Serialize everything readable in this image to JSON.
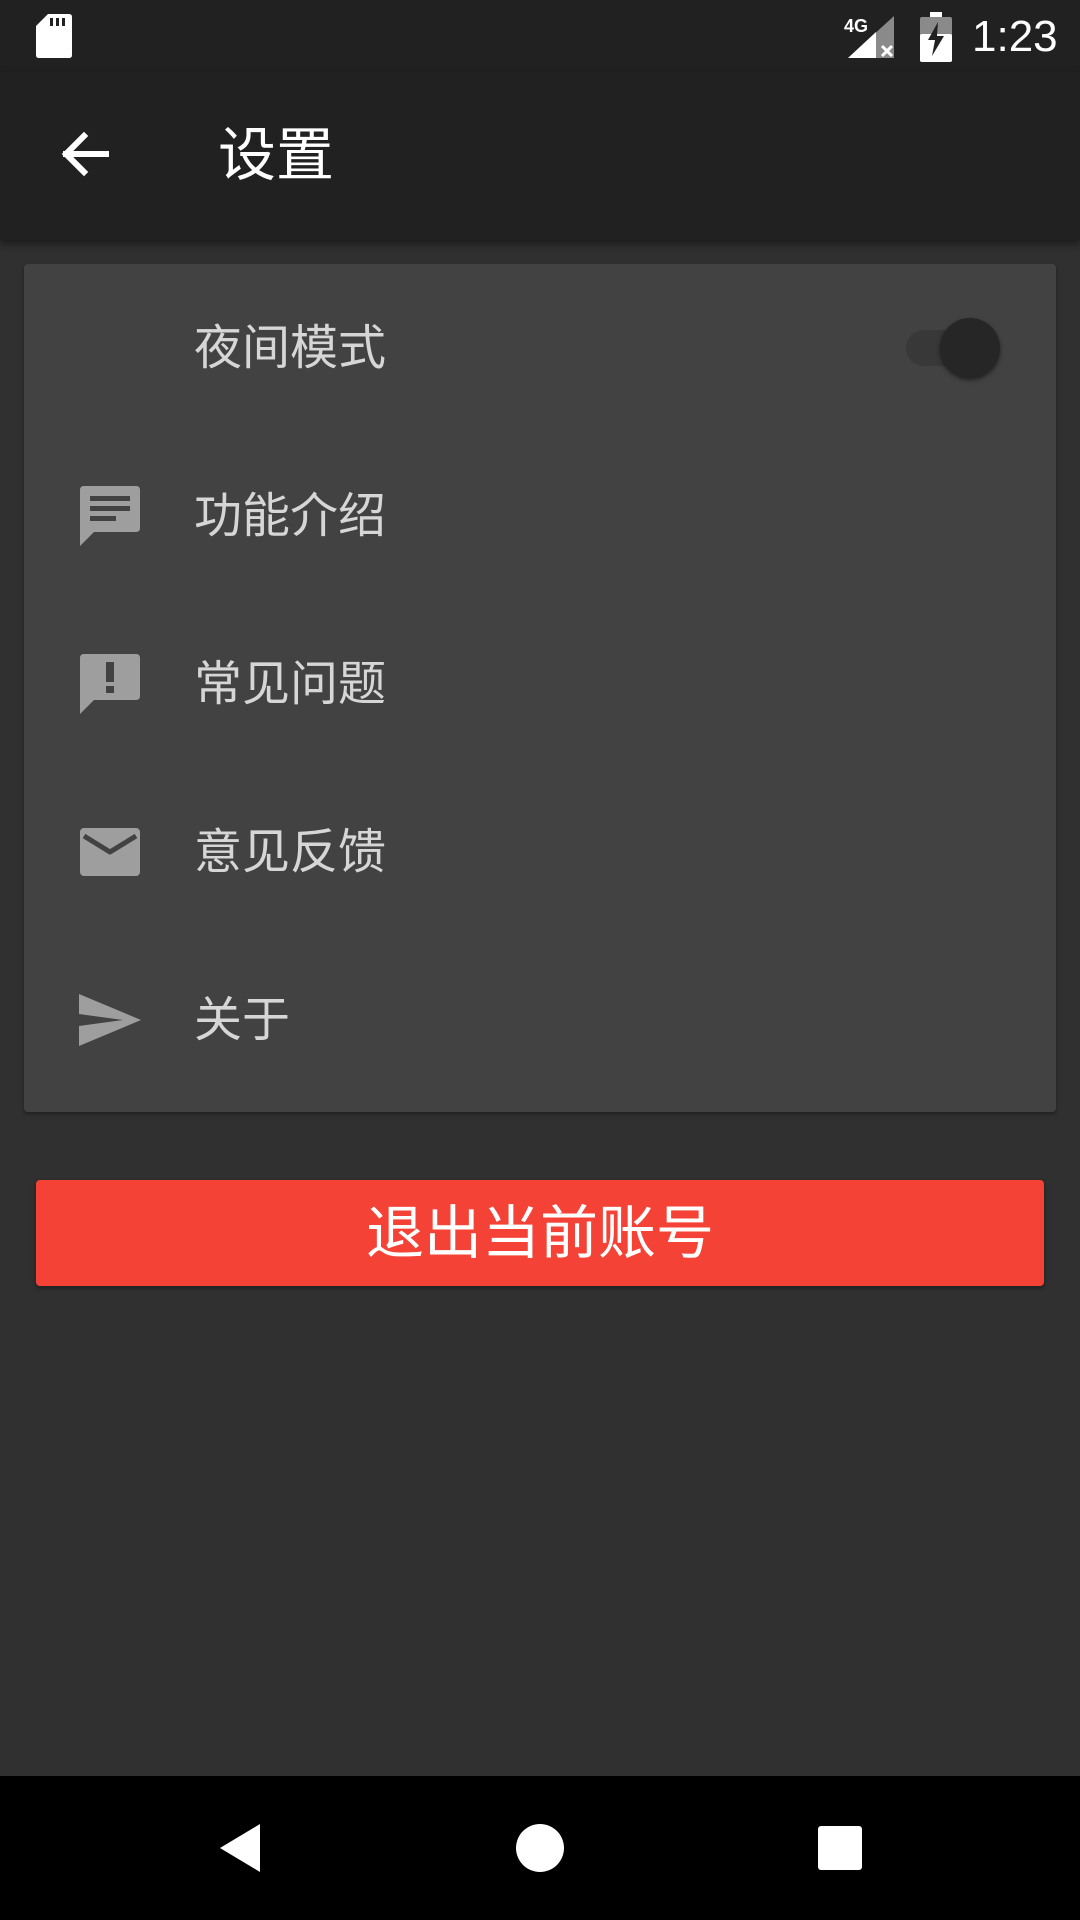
{
  "status_bar": {
    "time": "1:23",
    "network_label": "4G",
    "icons": [
      "sd-card-icon",
      "signal-4g-no-data-icon",
      "battery-charging-icon"
    ]
  },
  "app_bar": {
    "title": "设置",
    "back_icon": "arrow-back-icon"
  },
  "settings": {
    "items": [
      {
        "label": "夜间模式",
        "icon": "moon-icon",
        "has_toggle": true,
        "toggle_on": false
      },
      {
        "label": "功能介绍",
        "icon": "message-icon"
      },
      {
        "label": "常见问题",
        "icon": "feedback-alert-icon"
      },
      {
        "label": "意见反馈",
        "icon": "email-icon"
      },
      {
        "label": "关于",
        "icon": "send-icon"
      }
    ]
  },
  "logout": {
    "label": "退出当前账号",
    "color": "#f44336"
  },
  "nav_bar": {
    "buttons": [
      "back-triangle-icon",
      "home-circle-icon",
      "recents-square-icon"
    ]
  },
  "colors": {
    "background": "#303030",
    "app_bar": "#212121",
    "card": "#424242",
    "icon": "#9e9e9e",
    "text": "#d6d6d6",
    "accent_red": "#f44336"
  }
}
